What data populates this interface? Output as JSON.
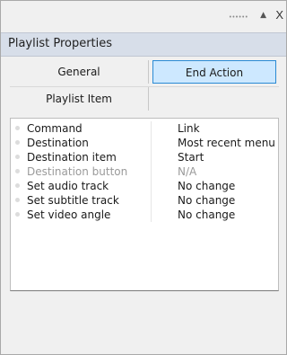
{
  "window": {
    "icons": [
      "grip-icon",
      "pin-icon",
      "close-icon"
    ],
    "pin_glyph": "▲",
    "close_glyph": "X"
  },
  "panel": {
    "title": "Playlist Properties"
  },
  "tabs": [
    {
      "label": "General",
      "selected": false
    },
    {
      "label": "End Action",
      "selected": true
    },
    {
      "label": "Playlist Item",
      "selected": false
    }
  ],
  "properties": [
    {
      "name": "Command",
      "value": "Link",
      "enabled": true
    },
    {
      "name": "Destination",
      "value": "Most recent menu",
      "enabled": true
    },
    {
      "name": "Destination item",
      "value": "Start",
      "enabled": true
    },
    {
      "name": "Destination button",
      "value": "N/A",
      "enabled": false
    },
    {
      "name": "Set audio track",
      "value": "No change",
      "enabled": true
    },
    {
      "name": "Set subtitle track",
      "value": "No change",
      "enabled": true
    },
    {
      "name": "Set video angle",
      "value": "No change",
      "enabled": true
    }
  ],
  "colors": {
    "header_bg": "#d7dee9",
    "selected_tab_bg": "#cde8ff",
    "selected_tab_border": "#2a8ad4",
    "disabled_text": "#9a9a9a"
  }
}
